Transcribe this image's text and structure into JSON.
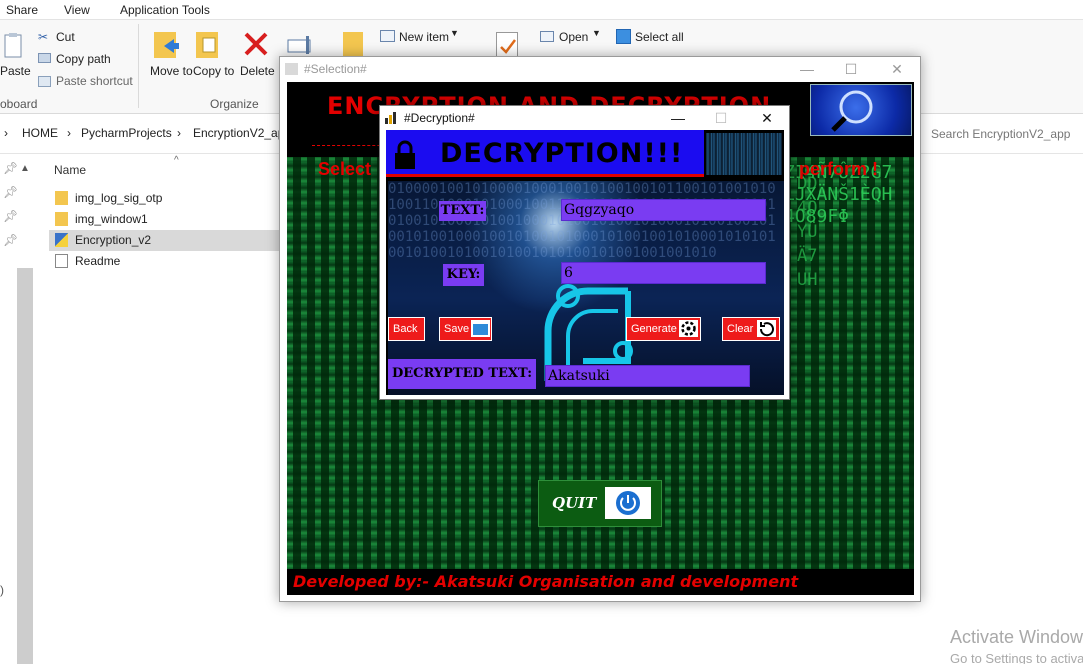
{
  "ribbon": {
    "tabs": [
      "Share",
      "View",
      "Application Tools"
    ],
    "clipboard": {
      "paste": "Paste",
      "cut": "Cut",
      "copy_path": "Copy path",
      "paste_shortcut": "Paste shortcut",
      "group": "oboard"
    },
    "organize": {
      "move_to": "Move to",
      "copy_to": "Copy to",
      "delete": "Delete",
      "group": "Organize"
    },
    "new_item": "New item",
    "open": "Open",
    "select_all": "Select all"
  },
  "address": {
    "crumbs": [
      "HOME",
      "PycharmProjects",
      "EncryptionV2_ap"
    ],
    "search_placeholder": "Search EncryptionV2_app"
  },
  "files": {
    "column_name": "Name",
    "items": [
      {
        "name": "img_log_sig_otp",
        "type": "folder"
      },
      {
        "name": "img_window1",
        "type": "folder"
      },
      {
        "name": "Encryption_v2",
        "type": "python"
      },
      {
        "name": "Readme",
        "type": "text"
      }
    ]
  },
  "selection_window": {
    "title": "#Selection#",
    "heading": "ENCRYPTION AND DECRYPTION",
    "prompt_start": "Select",
    "prompt_end": "perform !",
    "quit_label": "QUIT",
    "footer": "Developed by:-   Akatsuki Organisation and development",
    "matrix_glyphs": "ZI4Ñ7ÛZ2G7LJXÄNŠ1ÈQH4O89FΦ",
    "matrix_glyphs2": "DD4ÖYÜÄ7UH"
  },
  "decryption_window": {
    "title": "#Decryption#",
    "banner": "DECRYPTION!!!",
    "text_label": "TEXT:",
    "text_value": "Gqgzyaqo",
    "key_label": "KEY:",
    "key_value": "6",
    "buttons": {
      "back": "Back",
      "save": "Save",
      "generate": "Generate",
      "clear": "Clear"
    },
    "result_label": "DECRYPTED TEXT:",
    "result_value": "Akatsuki",
    "binary_bg": "0100001001010000100010010100100101100101001010100110100010100010011010010100101001001010010101001010001010010001010010100101000101001001010010100100010010100101000101001001010001010101001010010100101001010100101001001001010"
  },
  "watermark": {
    "line1": "Activate Windows",
    "line2": "Go to Settings to activate Windows."
  },
  "colors": {
    "accent_red": "#e30000",
    "purple": "#7a3cf2",
    "banner_blue": "#1b0cf0"
  }
}
